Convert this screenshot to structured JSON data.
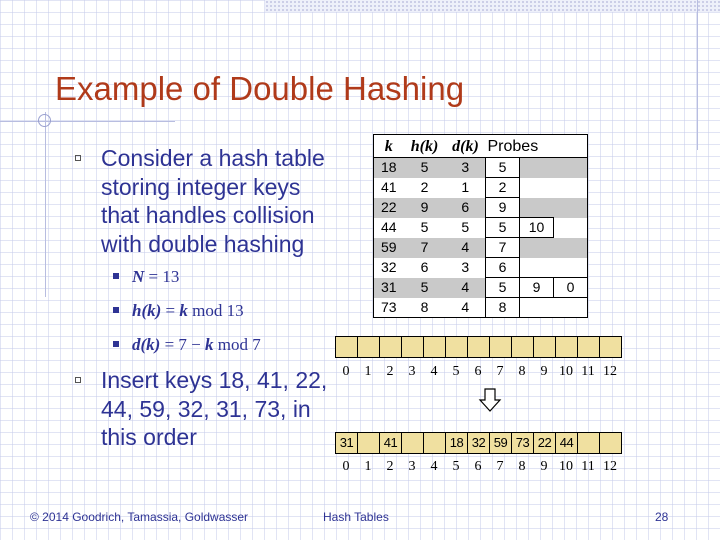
{
  "slide": {
    "title": "Example of Double Hashing",
    "bullets": [
      "Consider a hash table storing integer keys that handles collision with double hashing",
      "Insert keys 18, 41, 22, 44, 59, 32, 31, 73, in this order"
    ],
    "sub_bullets": [
      {
        "lhs": "N",
        "rhs": " = 13"
      },
      {
        "lhs": "h(k)",
        "rhs": " = ",
        "k": "k",
        "tail": " mod 13"
      },
      {
        "lhs": "d(k)",
        "rhs": " = 7 − ",
        "k": "k",
        "tail": " mod 7"
      }
    ],
    "footer": {
      "copyright": "© 2014 Goodrich, Tamassia, Goldwasser",
      "topic": "Hash Tables",
      "page": "28"
    }
  },
  "probe_table": {
    "headers": [
      "k",
      "h(k)",
      "d(k)",
      "Probes"
    ],
    "rows": [
      {
        "k": "18",
        "h": "5",
        "d": "3",
        "probes": [
          "5"
        ]
      },
      {
        "k": "41",
        "h": "2",
        "d": "1",
        "probes": [
          "2"
        ]
      },
      {
        "k": "22",
        "h": "9",
        "d": "6",
        "probes": [
          "9"
        ]
      },
      {
        "k": "44",
        "h": "5",
        "d": "5",
        "probes": [
          "5",
          "10"
        ]
      },
      {
        "k": "59",
        "h": "7",
        "d": "4",
        "probes": [
          "7"
        ]
      },
      {
        "k": "32",
        "h": "6",
        "d": "3",
        "probes": [
          "6"
        ]
      },
      {
        "k": "31",
        "h": "5",
        "d": "4",
        "probes": [
          "5",
          "9",
          "0"
        ]
      },
      {
        "k": "73",
        "h": "8",
        "d": "4",
        "probes": [
          "8"
        ]
      }
    ]
  },
  "empty_array": {
    "cells": [
      "",
      "",
      "",
      "",
      "",
      "",
      "",
      "",
      "",
      "",
      "",
      "",
      ""
    ],
    "indices": [
      "0",
      "1",
      "2",
      "3",
      "4",
      "5",
      "6",
      "7",
      "8",
      "9",
      "10",
      "11",
      "12"
    ]
  },
  "filled_array": {
    "cells": [
      "31",
      "",
      "41",
      "",
      "",
      "18",
      "32",
      "59",
      "73",
      "22",
      "44",
      "",
      ""
    ],
    "indices": [
      "0",
      "1",
      "2",
      "3",
      "4",
      "5",
      "6",
      "7",
      "8",
      "9",
      "10",
      "11",
      "12"
    ]
  },
  "colors": {
    "title": "#b03a1a",
    "text": "#2e3394",
    "cell_fill": "#f0e0a0",
    "row_shade": "#c9c9c9"
  }
}
